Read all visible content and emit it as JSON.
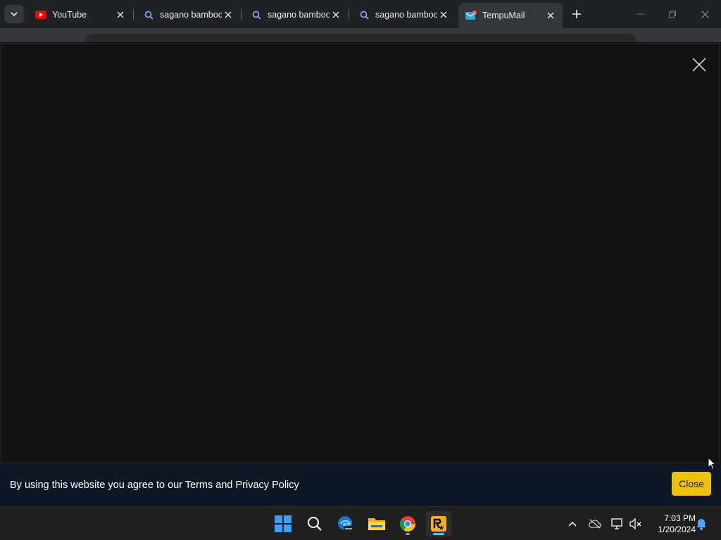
{
  "browser": {
    "tabs": [
      {
        "title": "YouTube",
        "favicon": "youtube-icon",
        "active": false
      },
      {
        "title": "sagano bamboo",
        "favicon": "search-icon",
        "active": false
      },
      {
        "title": "sagano bamboo",
        "favicon": "search-icon",
        "active": false
      },
      {
        "title": "sagano bamboo",
        "favicon": "search-icon",
        "active": false
      },
      {
        "title": "TempuMail",
        "favicon": "tempumail-icon",
        "active": true
      }
    ]
  },
  "cookie_banner": {
    "text": "By using this website you agree to our Terms and Privacy Policy",
    "close_label": "Close"
  },
  "taskbar": {
    "time": "7:03 PM",
    "date": "1/20/2024"
  },
  "colors": {
    "accent": "#efc10a",
    "banner_bg": "#0d1726",
    "modal_bg": "#121212"
  }
}
